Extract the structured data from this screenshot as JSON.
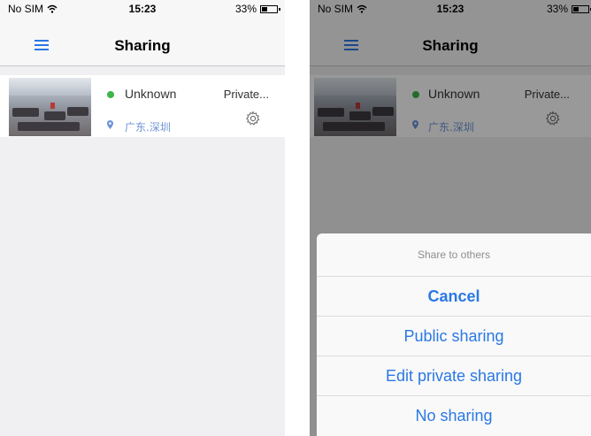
{
  "status_bar": {
    "carrier": "No SIM",
    "time": "15:23",
    "battery": "33%"
  },
  "nav": {
    "title": "Sharing"
  },
  "device": {
    "status": "Unknown",
    "location": "广东.深圳",
    "privacy": "Private..."
  },
  "action_sheet": {
    "title": "Share to others",
    "cancel": "Cancel",
    "options": [
      "Public sharing",
      "Edit private sharing",
      "No sharing"
    ]
  },
  "colors": {
    "accent": "#2a78e4",
    "online_dot": "#3db54a",
    "location": "#6f94d6"
  }
}
